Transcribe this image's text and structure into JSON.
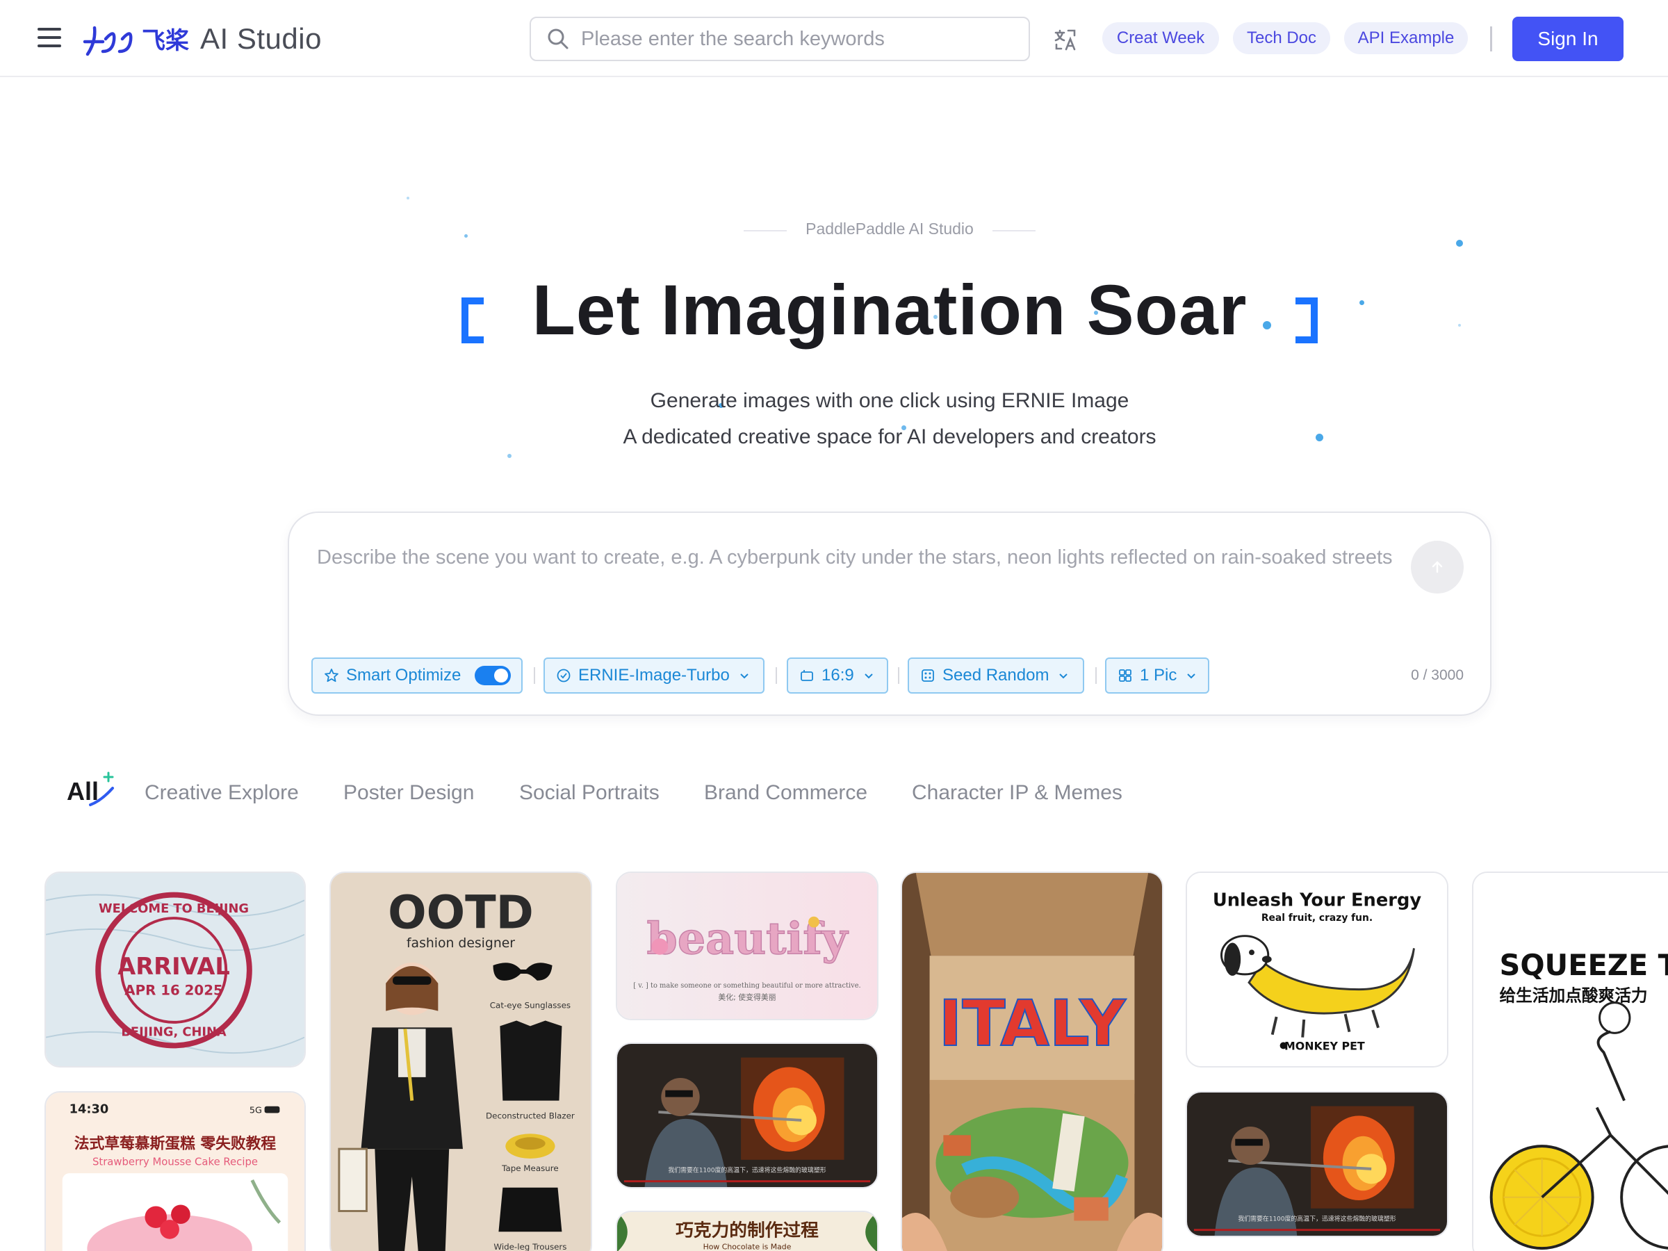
{
  "header": {
    "logo_brand": "飞桨",
    "logo_text": "AI Studio",
    "search_placeholder": "Please enter the search keywords",
    "links": [
      "Creat Week",
      "Tech Doc",
      "API Example"
    ],
    "signin_label": "Sign In"
  },
  "hero": {
    "eyebrow": "PaddlePaddle AI Studio",
    "title": "Let Imagination Soar",
    "subtitle_1": "Generate images with one click using ERNIE Image",
    "subtitle_2": "A dedicated creative space for AI developers and creators"
  },
  "prompt": {
    "placeholder": "Describe the scene you want to create, e.g. A cyberpunk city under the stars, neon lights reflected on rain-soaked streets",
    "smart_optimize_label": "Smart Optimize",
    "smart_optimize_on": true,
    "model": "ERNIE-Image-Turbo",
    "ratio": "16:9",
    "seed": "Seed Random",
    "count": "1 Pic",
    "counter": "0 / 3000"
  },
  "tabs": {
    "all": "All",
    "items": [
      "Creative Explore",
      "Poster Design",
      "Social Portraits",
      "Brand Commerce",
      "Character IP & Memes"
    ]
  },
  "gallery": {
    "stamp": {
      "line1": "WELCOME TO BEIJING",
      "line2": "ARRIVAL",
      "line3": "APR 16 2025",
      "line4": "BEIJING, CHINA"
    },
    "ootd": {
      "title": "OOTD",
      "subtitle": "fashion designer",
      "items": [
        "Cat-eye Sunglasses",
        "Deconstructed Blazer",
        "Tape Measure",
        "Wide-leg Trousers"
      ]
    },
    "beautify": {
      "word": "beautify",
      "def": "[ v. ] to make someone or something beautiful or more attractive.",
      "cn": "美化; 使变得美丽"
    },
    "italy": {
      "word": "ITALY"
    },
    "energy": {
      "title": "Unleash Your Energy",
      "tagline": "Real fruit, crazy fun.",
      "brand": "MONKEY PET"
    },
    "squeeze": {
      "title": "SQUEEZE THE D",
      "cn": "给生活加点酸爽活力"
    },
    "recipe": {
      "time": "14:30",
      "signal": "5G",
      "title": "法式草莓慕斯蛋糕 零失败教程",
      "subtitle": "Strawberry Mousse Cake Recipe"
    },
    "chocolate": {
      "title": "巧克力的制作过程",
      "subtitle": "How Chocolate is Made"
    },
    "glass_caption": "我们需要在1100度的高温下，迅速将这些熔融的玻璃塑形"
  },
  "colors": {
    "accent": "#4353f5",
    "brand_blue": "#1a73ff",
    "option_text": "#1b88d6"
  }
}
